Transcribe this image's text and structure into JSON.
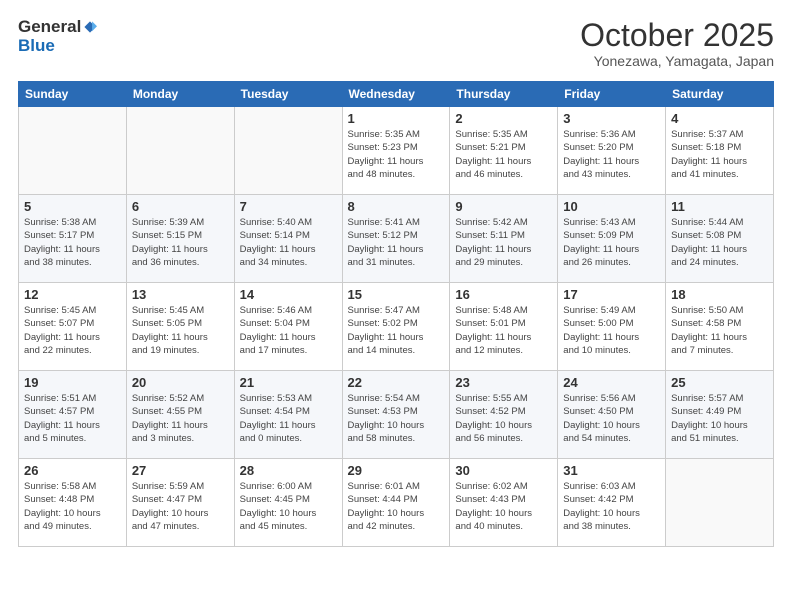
{
  "logo": {
    "general": "General",
    "blue": "Blue"
  },
  "header": {
    "month": "October 2025",
    "location": "Yonezawa, Yamagata, Japan"
  },
  "weekdays": [
    "Sunday",
    "Monday",
    "Tuesday",
    "Wednesday",
    "Thursday",
    "Friday",
    "Saturday"
  ],
  "weeks": [
    [
      {
        "day": "",
        "info": ""
      },
      {
        "day": "",
        "info": ""
      },
      {
        "day": "",
        "info": ""
      },
      {
        "day": "1",
        "info": "Sunrise: 5:35 AM\nSunset: 5:23 PM\nDaylight: 11 hours\nand 48 minutes."
      },
      {
        "day": "2",
        "info": "Sunrise: 5:35 AM\nSunset: 5:21 PM\nDaylight: 11 hours\nand 46 minutes."
      },
      {
        "day": "3",
        "info": "Sunrise: 5:36 AM\nSunset: 5:20 PM\nDaylight: 11 hours\nand 43 minutes."
      },
      {
        "day": "4",
        "info": "Sunrise: 5:37 AM\nSunset: 5:18 PM\nDaylight: 11 hours\nand 41 minutes."
      }
    ],
    [
      {
        "day": "5",
        "info": "Sunrise: 5:38 AM\nSunset: 5:17 PM\nDaylight: 11 hours\nand 38 minutes."
      },
      {
        "day": "6",
        "info": "Sunrise: 5:39 AM\nSunset: 5:15 PM\nDaylight: 11 hours\nand 36 minutes."
      },
      {
        "day": "7",
        "info": "Sunrise: 5:40 AM\nSunset: 5:14 PM\nDaylight: 11 hours\nand 34 minutes."
      },
      {
        "day": "8",
        "info": "Sunrise: 5:41 AM\nSunset: 5:12 PM\nDaylight: 11 hours\nand 31 minutes."
      },
      {
        "day": "9",
        "info": "Sunrise: 5:42 AM\nSunset: 5:11 PM\nDaylight: 11 hours\nand 29 minutes."
      },
      {
        "day": "10",
        "info": "Sunrise: 5:43 AM\nSunset: 5:09 PM\nDaylight: 11 hours\nand 26 minutes."
      },
      {
        "day": "11",
        "info": "Sunrise: 5:44 AM\nSunset: 5:08 PM\nDaylight: 11 hours\nand 24 minutes."
      }
    ],
    [
      {
        "day": "12",
        "info": "Sunrise: 5:45 AM\nSunset: 5:07 PM\nDaylight: 11 hours\nand 22 minutes."
      },
      {
        "day": "13",
        "info": "Sunrise: 5:45 AM\nSunset: 5:05 PM\nDaylight: 11 hours\nand 19 minutes."
      },
      {
        "day": "14",
        "info": "Sunrise: 5:46 AM\nSunset: 5:04 PM\nDaylight: 11 hours\nand 17 minutes."
      },
      {
        "day": "15",
        "info": "Sunrise: 5:47 AM\nSunset: 5:02 PM\nDaylight: 11 hours\nand 14 minutes."
      },
      {
        "day": "16",
        "info": "Sunrise: 5:48 AM\nSunset: 5:01 PM\nDaylight: 11 hours\nand 12 minutes."
      },
      {
        "day": "17",
        "info": "Sunrise: 5:49 AM\nSunset: 5:00 PM\nDaylight: 11 hours\nand 10 minutes."
      },
      {
        "day": "18",
        "info": "Sunrise: 5:50 AM\nSunset: 4:58 PM\nDaylight: 11 hours\nand 7 minutes."
      }
    ],
    [
      {
        "day": "19",
        "info": "Sunrise: 5:51 AM\nSunset: 4:57 PM\nDaylight: 11 hours\nand 5 minutes."
      },
      {
        "day": "20",
        "info": "Sunrise: 5:52 AM\nSunset: 4:55 PM\nDaylight: 11 hours\nand 3 minutes."
      },
      {
        "day": "21",
        "info": "Sunrise: 5:53 AM\nSunset: 4:54 PM\nDaylight: 11 hours\nand 0 minutes."
      },
      {
        "day": "22",
        "info": "Sunrise: 5:54 AM\nSunset: 4:53 PM\nDaylight: 10 hours\nand 58 minutes."
      },
      {
        "day": "23",
        "info": "Sunrise: 5:55 AM\nSunset: 4:52 PM\nDaylight: 10 hours\nand 56 minutes."
      },
      {
        "day": "24",
        "info": "Sunrise: 5:56 AM\nSunset: 4:50 PM\nDaylight: 10 hours\nand 54 minutes."
      },
      {
        "day": "25",
        "info": "Sunrise: 5:57 AM\nSunset: 4:49 PM\nDaylight: 10 hours\nand 51 minutes."
      }
    ],
    [
      {
        "day": "26",
        "info": "Sunrise: 5:58 AM\nSunset: 4:48 PM\nDaylight: 10 hours\nand 49 minutes."
      },
      {
        "day": "27",
        "info": "Sunrise: 5:59 AM\nSunset: 4:47 PM\nDaylight: 10 hours\nand 47 minutes."
      },
      {
        "day": "28",
        "info": "Sunrise: 6:00 AM\nSunset: 4:45 PM\nDaylight: 10 hours\nand 45 minutes."
      },
      {
        "day": "29",
        "info": "Sunrise: 6:01 AM\nSunset: 4:44 PM\nDaylight: 10 hours\nand 42 minutes."
      },
      {
        "day": "30",
        "info": "Sunrise: 6:02 AM\nSunset: 4:43 PM\nDaylight: 10 hours\nand 40 minutes."
      },
      {
        "day": "31",
        "info": "Sunrise: 6:03 AM\nSunset: 4:42 PM\nDaylight: 10 hours\nand 38 minutes."
      },
      {
        "day": "",
        "info": ""
      }
    ]
  ]
}
